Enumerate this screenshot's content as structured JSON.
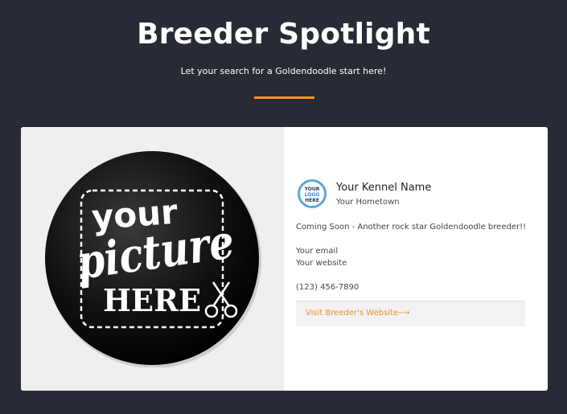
{
  "header": {
    "title": "Breeder Spotlight",
    "subtitle": "Let your search for a Goldendoodle start here!"
  },
  "colors": {
    "background": "#272b35",
    "accent": "#f7931e",
    "link": "#e8912b",
    "logo_ring": "#5aa8d8"
  },
  "card": {
    "image": {
      "line1": "your",
      "line2": "picture",
      "line3": "HERE",
      "icon": "scissors-icon"
    },
    "logo": {
      "line1": "YOUR",
      "line2": "LOGO",
      "line3": "HERE"
    },
    "kennel_name": "Your Kennel Name",
    "hometown": "Your Hometown",
    "description": "Coming Soon - Another rock star Goldendoodle breeder!!",
    "email": "Your email",
    "website": "Your website",
    "phone": "(123) 456-7890",
    "visit_link": "Visit Breeder's Website⟶"
  }
}
